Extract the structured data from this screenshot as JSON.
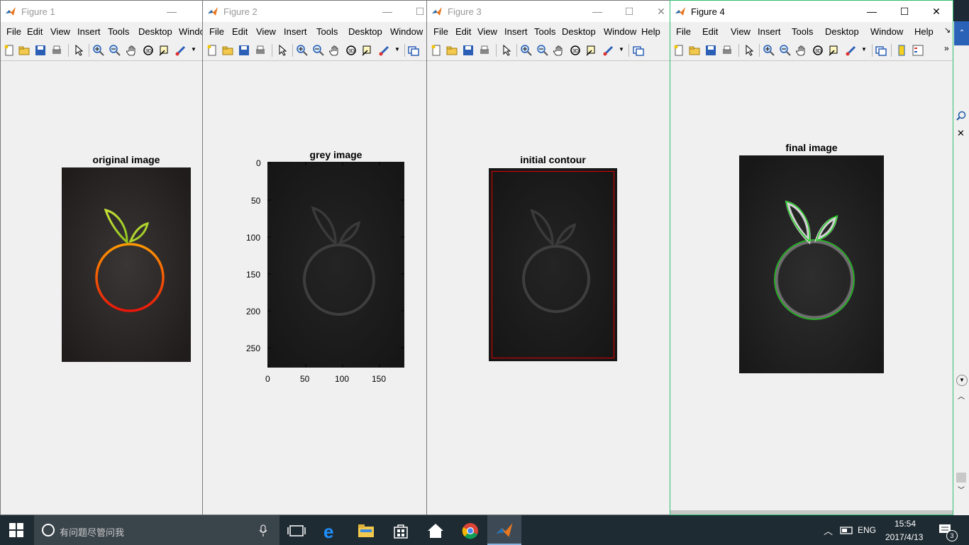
{
  "figures": [
    {
      "title": "Figure 1",
      "menu": [
        "File",
        "Edit",
        "View",
        "Insert",
        "Tools",
        "Desktop",
        "Windo"
      ],
      "axes_title": "original image"
    },
    {
      "title": "Figure 2",
      "menu": [
        "File",
        "Edit",
        "View",
        "Insert",
        "Tools",
        "Desktop",
        "Window"
      ],
      "axes_title": "grey image",
      "y_ticks": [
        "0",
        "50",
        "100",
        "150",
        "200",
        "250"
      ],
      "x_ticks": [
        "0",
        "50",
        "100",
        "150"
      ]
    },
    {
      "title": "Figure 3",
      "menu": [
        "File",
        "Edit",
        "View",
        "Insert",
        "Tools",
        "Desktop",
        "Window",
        "Help"
      ],
      "axes_title": "initial contour"
    },
    {
      "title": "Figure 4",
      "menu": [
        "File",
        "Edit",
        "View",
        "Insert",
        "Tools",
        "Desktop",
        "Window",
        "Help"
      ],
      "axes_title": "final image"
    }
  ],
  "taskbar": {
    "search_placeholder": "有问题尽管问我",
    "lang": "ENG",
    "time": "15:54",
    "date": "2017/4/13",
    "notifications": "3"
  },
  "colors": {
    "contour_initial": "#e00000",
    "contour_final": "#00cc00",
    "active_border": "#2fbf71"
  }
}
